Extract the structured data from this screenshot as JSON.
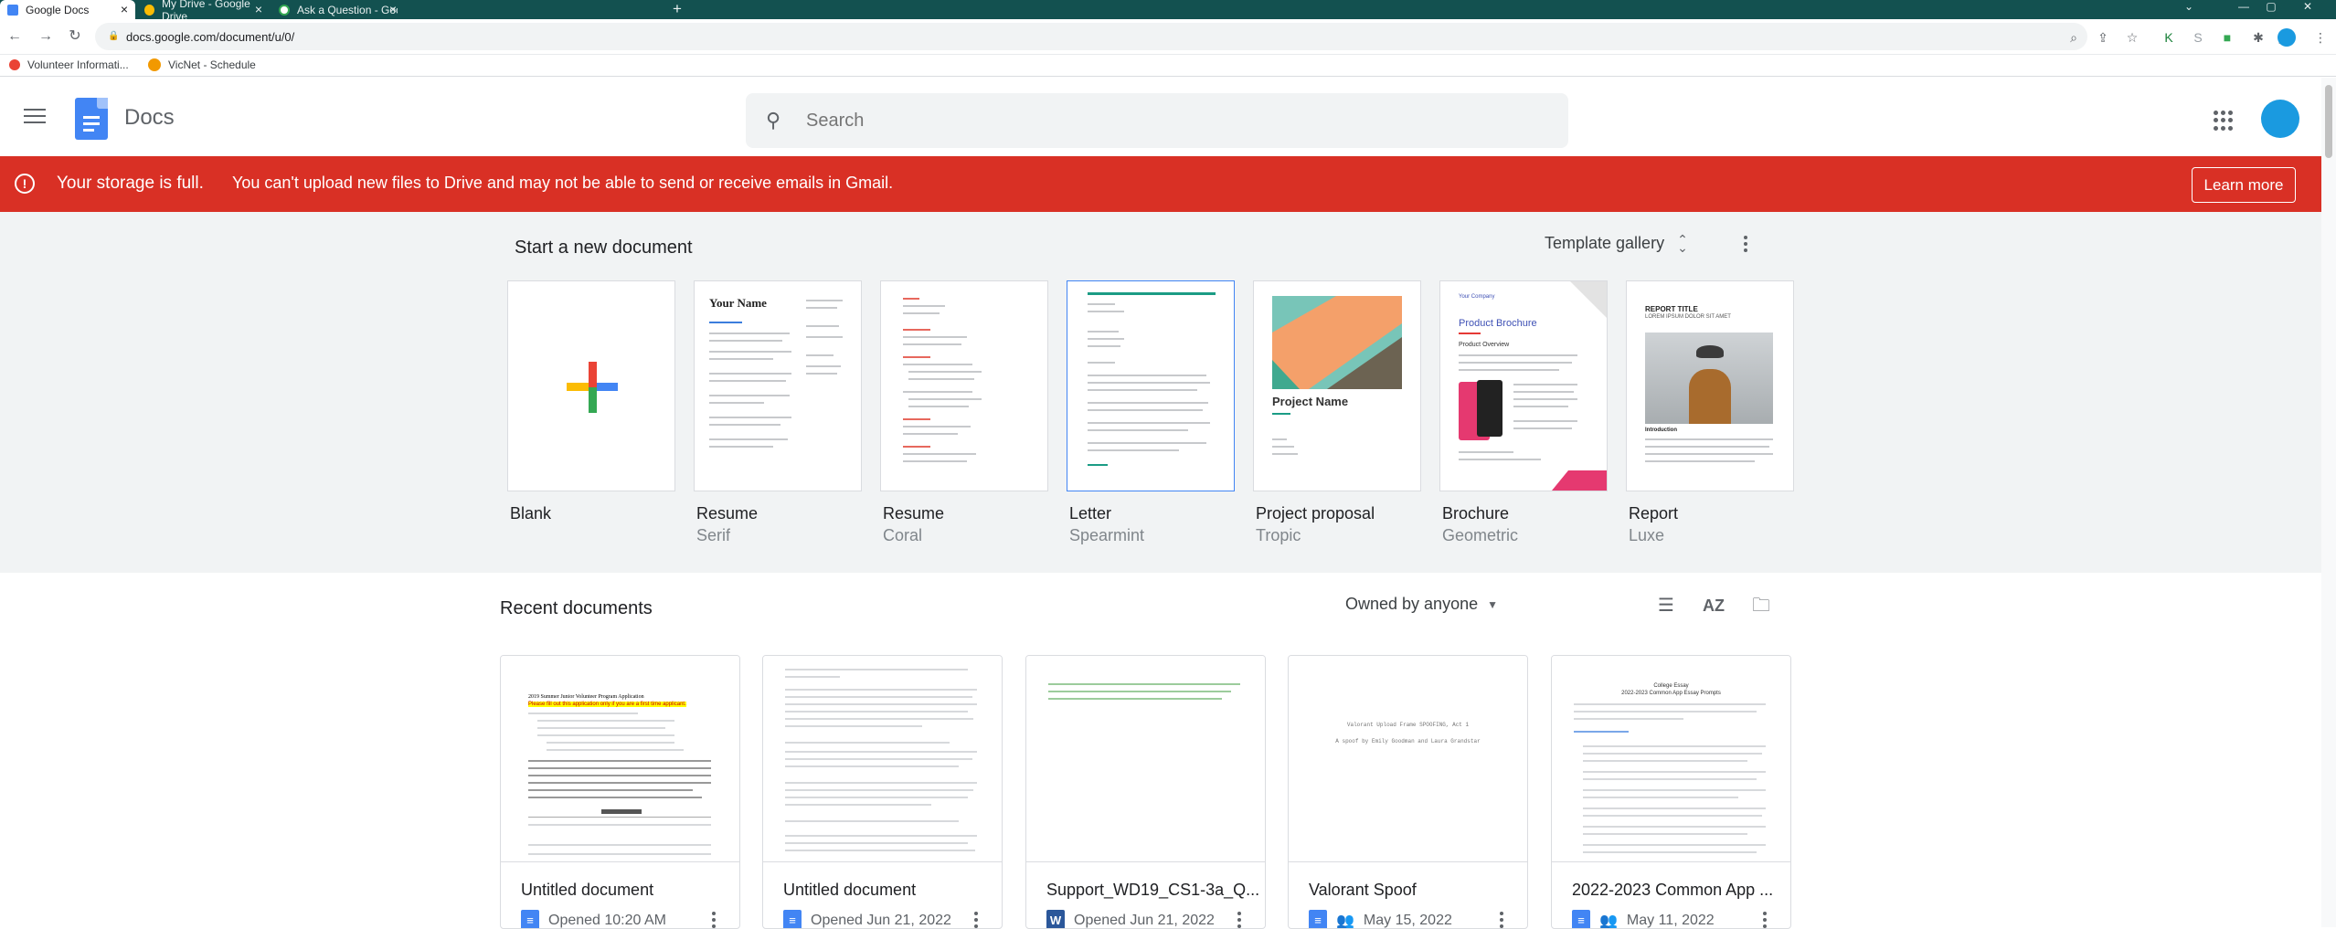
{
  "browser": {
    "tabs": [
      {
        "title": "Google Docs",
        "active": true,
        "favicon_color": "#4285f4"
      },
      {
        "title": "My Drive - Google Drive",
        "active": false,
        "favicon_color": "#fbbc04"
      },
      {
        "title": "Ask a Question - Google Docs Ed",
        "active": false,
        "favicon_color": "#34a853"
      }
    ],
    "new_tab": "+",
    "url": "docs.google.com/document/u/0/",
    "bookmarks": [
      {
        "label": "Volunteer Informati...",
        "color": "#ea4335"
      },
      {
        "label": "VicNet - Schedule",
        "color": "#f29900"
      }
    ]
  },
  "header": {
    "app_name": "Docs",
    "search_placeholder": "Search"
  },
  "banner": {
    "bold_text": "Your storage is full.",
    "message": "You can't upload new files to Drive and may not be able to send or receive emails in Gmail.",
    "button": "Learn more",
    "color": "#d93025"
  },
  "templates": {
    "section_title": "Start a new document",
    "gallery_label": "Template gallery",
    "items": [
      {
        "name": "Blank",
        "sub": ""
      },
      {
        "name": "Resume",
        "sub": "Serif"
      },
      {
        "name": "Resume",
        "sub": "Coral"
      },
      {
        "name": "Letter",
        "sub": "Spearmint"
      },
      {
        "name": "Project proposal",
        "sub": "Tropic"
      },
      {
        "name": "Brochure",
        "sub": "Geometric"
      },
      {
        "name": "Report",
        "sub": "Luxe"
      }
    ],
    "thumb_text": {
      "resume_serif_name": "Your Name",
      "proposal_title": "Project Name",
      "brochure_company": "Your Company",
      "brochure_title": "Product Brochure",
      "brochure_sub": "Product Overview",
      "report_title": "REPORT TITLE",
      "report_sub": "LOREM IPSUM DOLOR SIT AMET",
      "report_intro": "Introduction"
    }
  },
  "recent": {
    "section_title": "Recent documents",
    "owner_filter": "Owned by anyone",
    "docs": [
      {
        "name": "Untitled document",
        "meta": "Opened 10:20 AM",
        "icon": "docs",
        "shared": false,
        "preview_title": "2019 Summer Junior Volunteer Program Application",
        "preview_highlight": "Please fill out this application only if you are a first time applicant."
      },
      {
        "name": "Untitled document",
        "meta": "Opened Jun 21, 2022",
        "icon": "docs",
        "shared": false
      },
      {
        "name": "Support_WD19_CS1-3a_Q...",
        "meta": "Opened Jun 21, 2022",
        "icon": "word",
        "shared": false
      },
      {
        "name": "Valorant Spoof",
        "meta": "May 15, 2022",
        "icon": "docs",
        "shared": true,
        "preview_line1": "Valorant Upload Frame SPOOFING, Act 1",
        "preview_line2": "A spoof by Emily Goodman and Laura Grandstar"
      },
      {
        "name": "2022-2023 Common App ...",
        "meta": "May 11, 2022",
        "icon": "docs",
        "shared": true,
        "preview_title": "College Essay",
        "preview_sub": "2022-2023 Common App Essay Prompts"
      }
    ]
  }
}
